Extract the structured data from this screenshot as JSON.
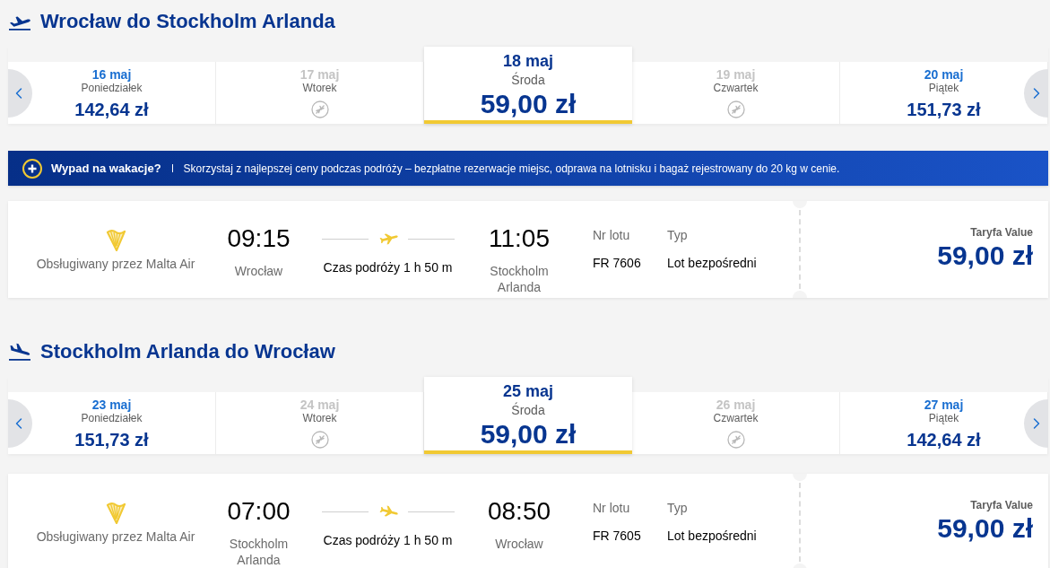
{
  "journeys": [
    {
      "kind": "outbound",
      "title": "Wrocław do Stockholm Arlanda",
      "dates": [
        {
          "date": "16 maj",
          "weekday": "Poniedziałek",
          "price": "142,64 zł",
          "available": true,
          "selected": false
        },
        {
          "date": "17 maj",
          "weekday": "Wtorek",
          "available": false,
          "selected": false
        },
        {
          "date": "18 maj",
          "weekday": "Środa",
          "price": "59,00 zł",
          "available": true,
          "selected": true
        },
        {
          "date": "19 maj",
          "weekday": "Czwartek",
          "available": false,
          "selected": false
        },
        {
          "date": "20 maj",
          "weekday": "Piątek",
          "price": "151,73 zł",
          "available": true,
          "selected": false
        }
      ],
      "banner": {
        "title": "Wypad na wakacje?",
        "text": "Skorzystaj z najlepszej ceny podczas podróży – bezpłatne rezerwacje miejsc, odprawa na lotnisku i bagaż rejestrowany do 20 kg w cenie."
      },
      "flight": {
        "operator": "Obsługiwany przez Malta Air",
        "departure_time": "09:15",
        "departure_airport": "Wrocław",
        "duration": "Czas podróży 1 h 50 m",
        "arrival_time": "11:05",
        "arrival_airport": "Stockholm Arlanda",
        "flight_number_label": "Nr lotu",
        "flight_number": "FR 7606",
        "type_label": "Typ",
        "type": "Lot bezpośredni",
        "fare_label": "Taryfa Value",
        "price": "59,00 zł"
      }
    },
    {
      "kind": "inbound",
      "title": "Stockholm Arlanda do Wrocław",
      "dates": [
        {
          "date": "23 maj",
          "weekday": "Poniedziałek",
          "price": "151,73 zł",
          "available": true,
          "selected": false
        },
        {
          "date": "24 maj",
          "weekday": "Wtorek",
          "available": false,
          "selected": false
        },
        {
          "date": "25 maj",
          "weekday": "Środa",
          "price": "59,00 zł",
          "available": true,
          "selected": true
        },
        {
          "date": "26 maj",
          "weekday": "Czwartek",
          "available": false,
          "selected": false
        },
        {
          "date": "27 maj",
          "weekday": "Piątek",
          "price": "142,64 zł",
          "available": true,
          "selected": false
        }
      ],
      "flight": {
        "operator": "Obsługiwany przez Malta Air",
        "departure_time": "07:00",
        "departure_airport": "Stockholm Arlanda",
        "duration": "Czas podróży 1 h 50 m",
        "arrival_time": "08:50",
        "arrival_airport": "Wrocław",
        "flight_number_label": "Nr lotu",
        "flight_number": "FR 7605",
        "type_label": "Typ",
        "type": "Lot bezpośredni",
        "fare_label": "Taryfa Value",
        "price": "59,00 zł"
      }
    }
  ]
}
